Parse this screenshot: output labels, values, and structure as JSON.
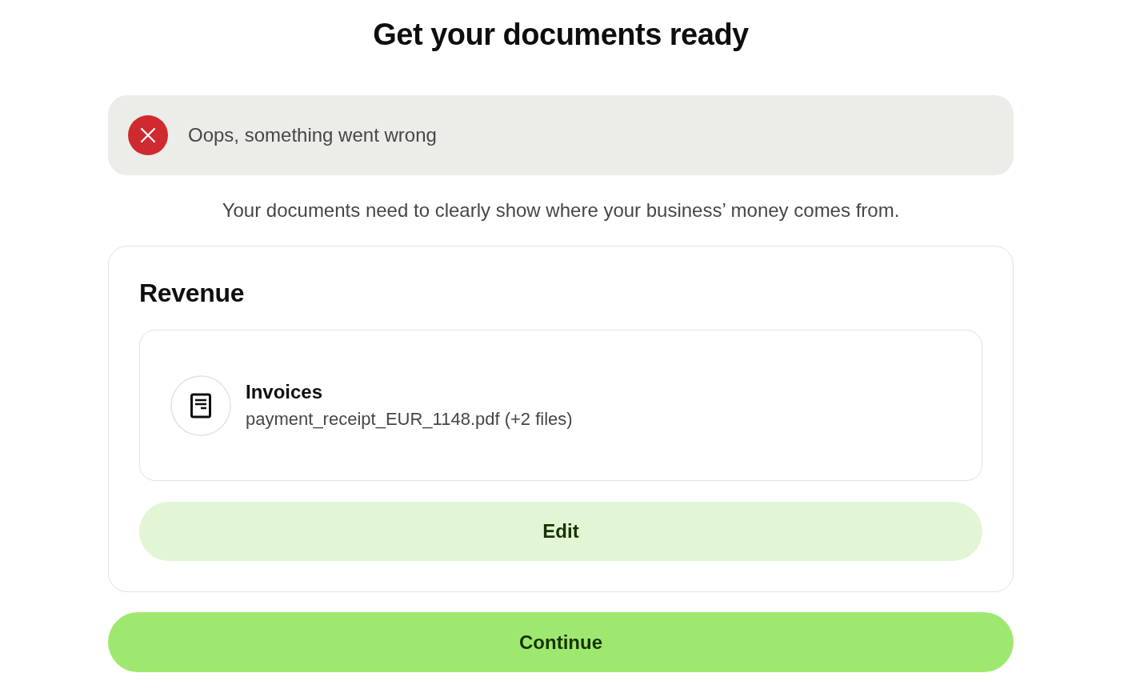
{
  "page": {
    "title": "Get your documents ready"
  },
  "alert": {
    "kind": "error",
    "message": "Oops, something went wrong"
  },
  "description": "Your documents need to clearly show where your business’ money comes from.",
  "section": {
    "title": "Revenue",
    "documents": [
      {
        "name": "Invoices",
        "files": "payment_receipt_EUR_1148.pdf (+2 files)"
      }
    ],
    "edit_button": "Edit"
  },
  "continue_button": "Continue"
}
